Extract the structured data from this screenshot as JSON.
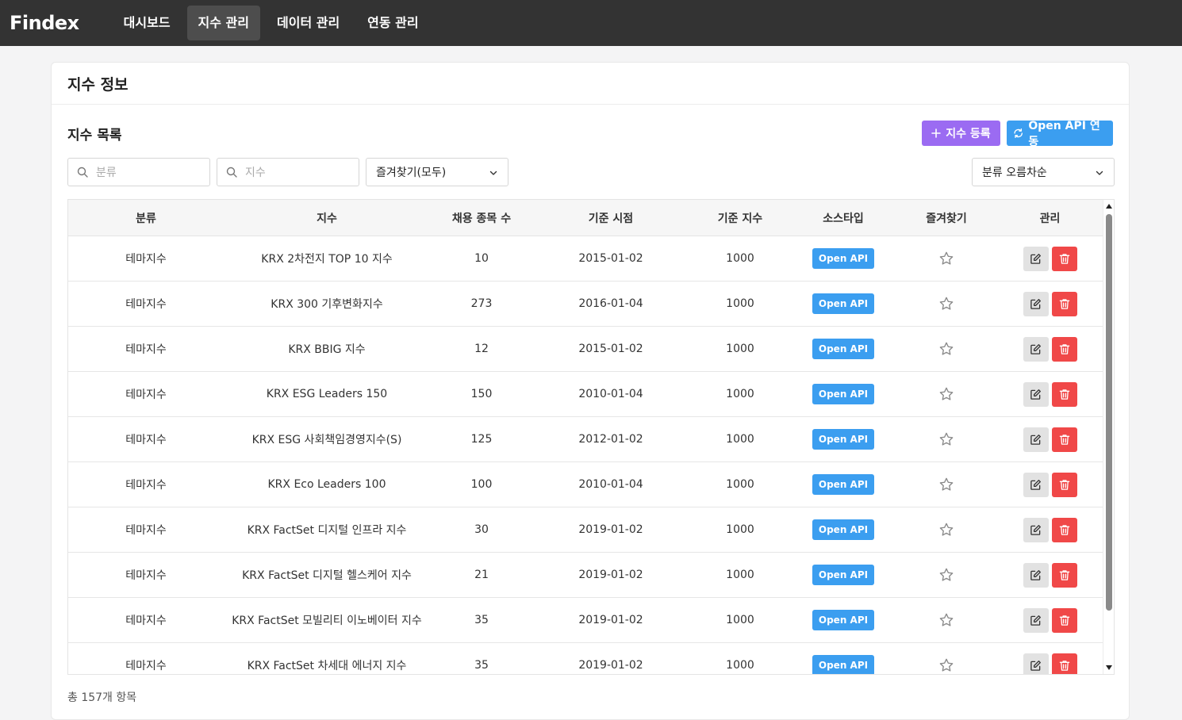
{
  "app": {
    "brand": "Findex"
  },
  "nav": [
    {
      "label": "대시보드",
      "active": false
    },
    {
      "label": "지수 관리",
      "active": true
    },
    {
      "label": "데이터 관리",
      "active": false
    },
    {
      "label": "연동 관리",
      "active": false
    }
  ],
  "page": {
    "title": "지수 정보"
  },
  "list": {
    "title": "지수 목록",
    "add_label": "지수 등록",
    "sync_label": "Open API 연동",
    "total": "총 157개 항목"
  },
  "filters": {
    "category_placeholder": "분류",
    "index_placeholder": "지수",
    "favorite_value": "즐겨찾기(모두)",
    "sort_value": "분류 오름차순"
  },
  "table": {
    "columns": [
      "분류",
      "지수",
      "채용 종목 수",
      "기준 시점",
      "기준 지수",
      "소스타입",
      "즐겨찾기",
      "관리"
    ],
    "rows": [
      {
        "category": "테마지수",
        "name": "KRX 2차전지 TOP 10 지수",
        "count": "10",
        "base_date": "2015-01-02",
        "base_index": "1000",
        "source": "Open API"
      },
      {
        "category": "테마지수",
        "name": "KRX 300 기후변화지수",
        "count": "273",
        "base_date": "2016-01-04",
        "base_index": "1000",
        "source": "Open API"
      },
      {
        "category": "테마지수",
        "name": "KRX BBIG 지수",
        "count": "12",
        "base_date": "2015-01-02",
        "base_index": "1000",
        "source": "Open API"
      },
      {
        "category": "테마지수",
        "name": "KRX ESG Leaders 150",
        "count": "150",
        "base_date": "2010-01-04",
        "base_index": "1000",
        "source": "Open API"
      },
      {
        "category": "테마지수",
        "name": "KRX ESG 사회책임경영지수(S)",
        "count": "125",
        "base_date": "2012-01-02",
        "base_index": "1000",
        "source": "Open API"
      },
      {
        "category": "테마지수",
        "name": "KRX Eco Leaders 100",
        "count": "100",
        "base_date": "2010-01-04",
        "base_index": "1000",
        "source": "Open API"
      },
      {
        "category": "테마지수",
        "name": "KRX FactSet 디지털 인프라 지수",
        "count": "30",
        "base_date": "2019-01-02",
        "base_index": "1000",
        "source": "Open API"
      },
      {
        "category": "테마지수",
        "name": "KRX FactSet 디지털 헬스케어 지수",
        "count": "21",
        "base_date": "2019-01-02",
        "base_index": "1000",
        "source": "Open API"
      },
      {
        "category": "테마지수",
        "name": "KRX FactSet 모빌리티 이노베이터 지수",
        "count": "35",
        "base_date": "2019-01-02",
        "base_index": "1000",
        "source": "Open API"
      },
      {
        "category": "테마지수",
        "name": "KRX FactSet 차세대 에너지 지수",
        "count": "35",
        "base_date": "2019-01-02",
        "base_index": "1000",
        "source": "Open API"
      }
    ]
  },
  "colors": {
    "nav_bg": "#333333",
    "primary_purple": "#9b6bf2",
    "accent_blue": "#3b9ef0",
    "danger_red": "#f04848"
  },
  "icons": {
    "add": "plus-icon",
    "sync": "refresh-icon",
    "search": "search-icon",
    "dropdown": "chevron-down-icon",
    "favorite": "star-outline-icon",
    "edit": "edit-icon",
    "delete": "trash-icon"
  }
}
